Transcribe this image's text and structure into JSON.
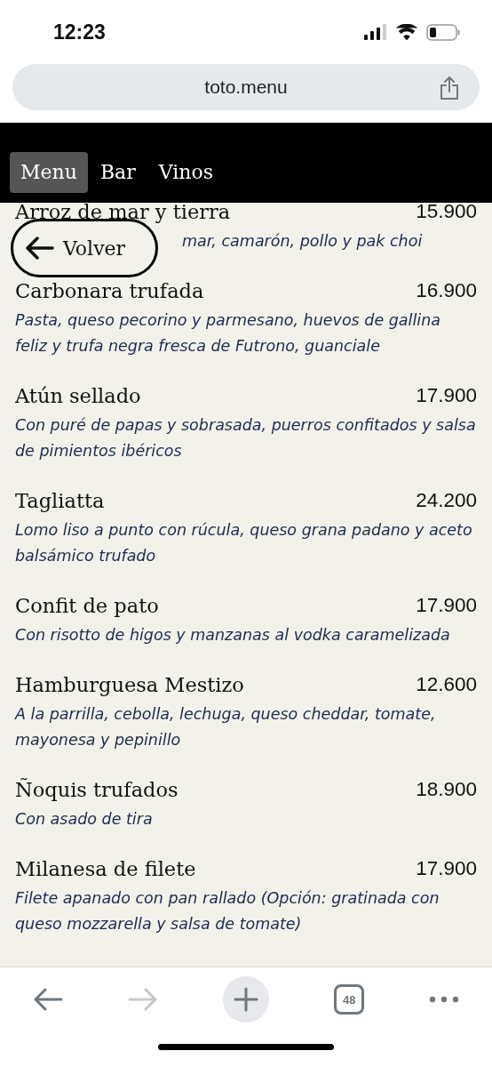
{
  "status_bar": {
    "time": "12:23"
  },
  "address_bar": {
    "url": "toto.menu"
  },
  "tabs": [
    {
      "label": "Menu",
      "selected": true
    },
    {
      "label": "Bar",
      "selected": false
    },
    {
      "label": "Vinos",
      "selected": false
    }
  ],
  "back_button": {
    "label": "Volver"
  },
  "dishes": [
    {
      "name": "Arroz de mar y tierra",
      "price": "15.900",
      "description": "mar, camarón, pollo y pak choi",
      "partly_hidden": true
    },
    {
      "name": "Carbonara trufada",
      "price": "16.900",
      "description": "Pasta, queso pecorino y parmesano, huevos de gallina feliz y trufa negra fresca de Futrono, guanciale"
    },
    {
      "name": "Atún sellado",
      "price": "17.900",
      "description": "Con puré de papas y sobrasada, puerros confitados y salsa de pimientos ibéricos"
    },
    {
      "name": "Tagliatta",
      "price": "24.200",
      "description": "Lomo liso a punto con rúcula, queso grana padano y aceto balsámico trufado"
    },
    {
      "name": "Confit de pato",
      "price": "17.900",
      "description": "Con risotto de higos y manzanas al vodka caramelizada"
    },
    {
      "name": "Hamburguesa Mestizo",
      "price": "12.600",
      "description": "A la parrilla, cebolla, lechuga, queso cheddar, tomate, mayonesa y pepinillo"
    },
    {
      "name": "Ñoquis trufados",
      "price": "18.900",
      "description": "Con asado de tira"
    },
    {
      "name": "Milanesa de filete",
      "price": "17.900",
      "description": "Filete apanado con pan rallado (Opción: gratinada con queso mozzarella y salsa de tomate)"
    }
  ],
  "toolbar": {
    "forward_disabled": true,
    "tab_count": "48"
  }
}
